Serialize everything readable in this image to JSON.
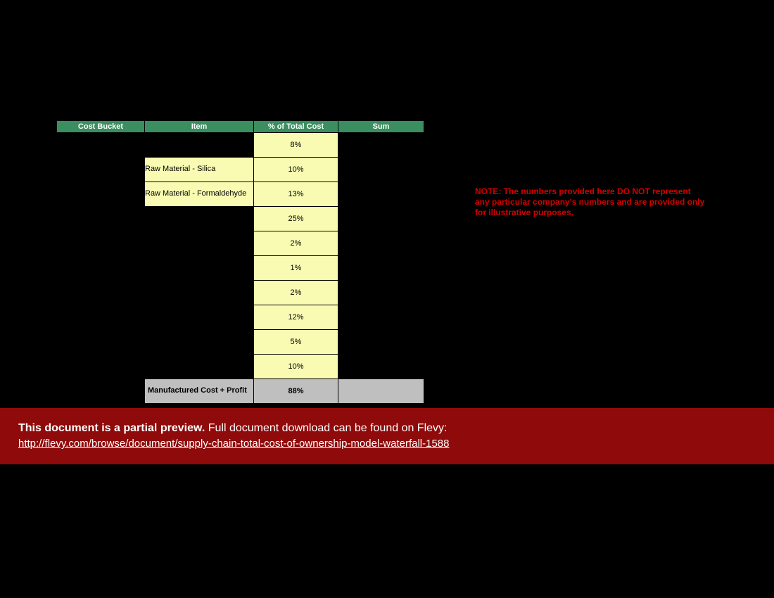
{
  "headers": {
    "bucket": "Cost Bucket",
    "item": "Item",
    "pct": "% of Total Cost",
    "sum": "Sum"
  },
  "rows": [
    {
      "item": "",
      "pct": "8%"
    },
    {
      "item": "Raw Material - Silica",
      "pct": "10%"
    },
    {
      "item": "Raw Material - Formaldehyde",
      "pct": "13%"
    },
    {
      "item": "",
      "pct": "25%"
    },
    {
      "item": "",
      "pct": "2%"
    },
    {
      "item": "",
      "pct": "1%"
    },
    {
      "item": "",
      "pct": "2%"
    },
    {
      "item": "",
      "pct": "12%"
    },
    {
      "item": "",
      "pct": "5%"
    },
    {
      "item": "",
      "pct": "10%"
    }
  ],
  "subtotal": {
    "item": "Manufactured Cost + Profit",
    "pct": "88%",
    "sum": ""
  },
  "note": "NOTE: The numbers provided here DO NOT represent any particular company's numbers and are provided only for illustrative purposes.",
  "banner": {
    "bold": "This document is a partial preview.",
    "rest": "  Full document download can be found on Flevy:",
    "link_text": "http://flevy.com/browse/document/supply-chain-total-cost-of-ownership-model-waterfall-1588",
    "link_href": "http://flevy.com/browse/document/supply-chain-total-cost-of-ownership-model-waterfall-1588"
  }
}
